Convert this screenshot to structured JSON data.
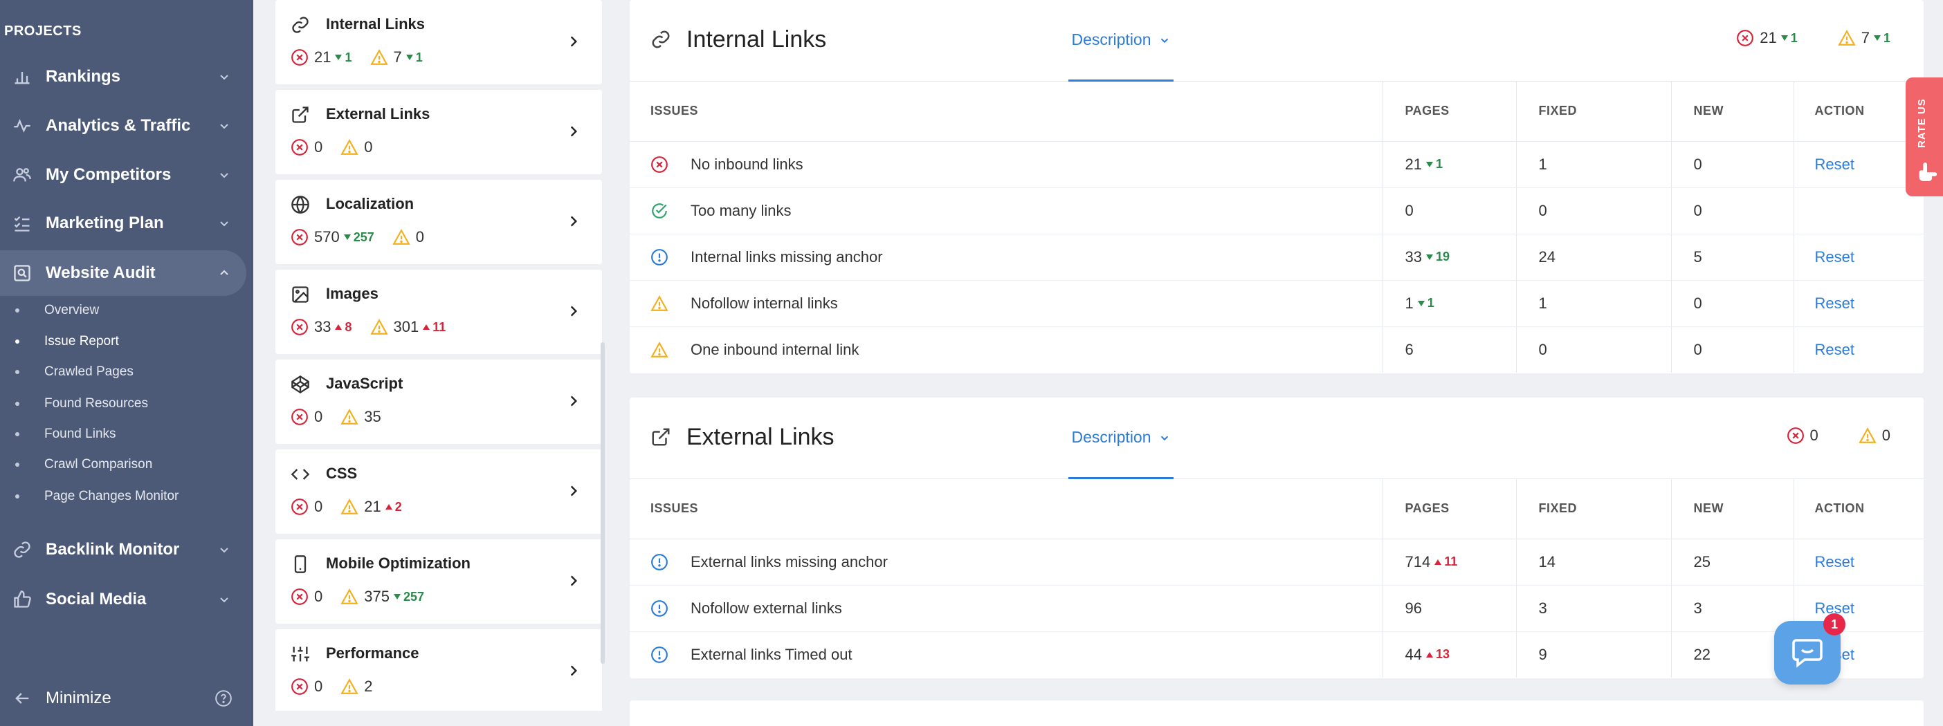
{
  "sidebar": {
    "projects_label": "PROJECTS",
    "nav": [
      {
        "label": "Rankings",
        "icon": "bar-chart-icon"
      },
      {
        "label": "Analytics & Traffic",
        "icon": "pulse-icon"
      },
      {
        "label": "My Competitors",
        "icon": "users-icon"
      },
      {
        "label": "Marketing Plan",
        "icon": "checklist-icon"
      },
      {
        "label": "Website Audit",
        "icon": "audit-icon"
      },
      {
        "label": "Backlink Monitor",
        "icon": "link-icon"
      },
      {
        "label": "Social Media",
        "icon": "thumbs-up-icon"
      }
    ],
    "sub_items": [
      "Overview",
      "Issue Report",
      "Crawled Pages",
      "Found Resources",
      "Found Links",
      "Crawl Comparison",
      "Page Changes Monitor"
    ],
    "active_sub": "Issue Report",
    "minimize_label": "Minimize"
  },
  "categories": [
    {
      "title": "Internal Links",
      "icon": "link-icon",
      "errors": "21",
      "errors_delta": "1",
      "errors_dir": "down",
      "warnings": "7",
      "warnings_delta": "1",
      "warnings_dir": "down"
    },
    {
      "title": "External Links",
      "icon": "external-link-icon",
      "errors": "0",
      "errors_delta": "",
      "errors_dir": "",
      "warnings": "0",
      "warnings_delta": "",
      "warnings_dir": ""
    },
    {
      "title": "Localization",
      "icon": "globe-icon",
      "errors": "570",
      "errors_delta": "257",
      "errors_dir": "down",
      "warnings": "0",
      "warnings_delta": "",
      "warnings_dir": ""
    },
    {
      "title": "Images",
      "icon": "image-icon",
      "errors": "33",
      "errors_delta": "8",
      "errors_dir": "up",
      "warnings": "301",
      "warnings_delta": "11",
      "warnings_dir": "up"
    },
    {
      "title": "JavaScript",
      "icon": "codepen-icon",
      "errors": "0",
      "errors_delta": "",
      "errors_dir": "",
      "warnings": "35",
      "warnings_delta": "",
      "warnings_dir": ""
    },
    {
      "title": "CSS",
      "icon": "code-icon",
      "errors": "0",
      "errors_delta": "",
      "errors_dir": "",
      "warnings": "21",
      "warnings_delta": "2",
      "warnings_dir": "up"
    },
    {
      "title": "Mobile Optimization",
      "icon": "mobile-icon",
      "errors": "0",
      "errors_delta": "",
      "errors_dir": "",
      "warnings": "375",
      "warnings_delta": "257",
      "warnings_dir": "down"
    },
    {
      "title": "Performance",
      "icon": "sliders-icon",
      "errors": "0",
      "errors_delta": "",
      "errors_dir": "",
      "warnings": "2",
      "warnings_delta": "",
      "warnings_dir": ""
    }
  ],
  "panels": [
    {
      "title": "Internal Links",
      "description_label": "Description",
      "errors": "21",
      "errors_delta": "1",
      "warnings": "7",
      "warnings_delta": "1",
      "columns": [
        "ISSUES",
        "PAGES",
        "FIXED",
        "NEW",
        "ACTION"
      ],
      "rows": [
        {
          "status": "error",
          "issue": "No inbound links",
          "pages": "21",
          "delta": "1",
          "dir": "down",
          "fixed": "1",
          "new": "0",
          "action": "Reset"
        },
        {
          "status": "ok",
          "issue": "Too many links",
          "pages": "0",
          "delta": "",
          "dir": "",
          "fixed": "0",
          "new": "0",
          "action": ""
        },
        {
          "status": "info",
          "issue": "Internal links missing anchor",
          "pages": "33",
          "delta": "19",
          "dir": "down",
          "fixed": "24",
          "new": "5",
          "action": "Reset"
        },
        {
          "status": "warning",
          "issue": "Nofollow internal links",
          "pages": "1",
          "delta": "1",
          "dir": "down",
          "fixed": "1",
          "new": "0",
          "action": "Reset"
        },
        {
          "status": "warning",
          "issue": "One inbound internal link",
          "pages": "6",
          "delta": "",
          "dir": "",
          "fixed": "0",
          "new": "0",
          "action": "Reset"
        }
      ]
    },
    {
      "title": "External Links",
      "description_label": "Description",
      "errors": "0",
      "errors_delta": "",
      "warnings": "0",
      "warnings_delta": "",
      "columns": [
        "ISSUES",
        "PAGES",
        "FIXED",
        "NEW",
        "ACTION"
      ],
      "rows": [
        {
          "status": "info",
          "issue": "External links missing anchor",
          "pages": "714",
          "delta": "11",
          "dir": "up",
          "fixed": "14",
          "new": "25",
          "action": "Reset"
        },
        {
          "status": "info",
          "issue": "Nofollow external links",
          "pages": "96",
          "delta": "",
          "dir": "",
          "fixed": "3",
          "new": "3",
          "action": "Reset"
        },
        {
          "status": "info",
          "issue": "External links Timed out",
          "pages": "44",
          "delta": "13",
          "dir": "up",
          "fixed": "9",
          "new": "22",
          "action": "Reset"
        }
      ]
    }
  ],
  "widgets": {
    "rate_us_label": "RATE US",
    "chat_badge": "1"
  },
  "colors": {
    "sidebar_bg": "#4c5a77",
    "accent_blue": "#2b7bd8",
    "error_red": "#d6243b",
    "warning_yellow": "#f2b01e",
    "ok_green": "#2fa36b",
    "delta_down_green": "#2a8a4a"
  }
}
